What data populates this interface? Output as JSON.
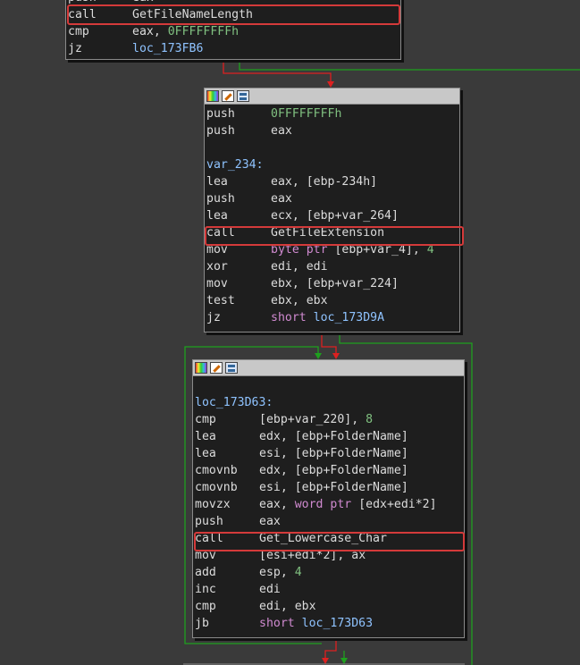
{
  "block1": {
    "lines": [
      {
        "mn": "push",
        "ops": [
          {
            "t": "eax",
            "c": "reg"
          }
        ]
      },
      {
        "mn": "call",
        "ops": [
          {
            "t": "GetFileNameLength",
            "c": "func"
          }
        ]
      },
      {
        "mn": "cmp",
        "ops": [
          {
            "t": "eax",
            "c": "reg"
          },
          {
            "t": ", ",
            "c": "sym"
          },
          {
            "t": "0FFFFFFFFh",
            "c": "num"
          }
        ]
      },
      {
        "mn": "jz",
        "ops": [
          {
            "t": "loc_173FB6",
            "c": "lbl"
          }
        ]
      }
    ]
  },
  "block2": {
    "lines": [
      {
        "mn": "push",
        "ops": [
          {
            "t": "0FFFFFFFFh",
            "c": "num"
          }
        ]
      },
      {
        "mn": "push",
        "ops": [
          {
            "t": "eax",
            "c": "reg"
          }
        ]
      },
      {
        "blank": true
      },
      {
        "label": "var_234:"
      },
      {
        "mn": "lea",
        "ops": [
          {
            "t": "eax",
            "c": "reg"
          },
          {
            "t": ", [",
            "c": "sym"
          },
          {
            "t": "ebp",
            "c": "reg"
          },
          {
            "t": "-234h]",
            "c": "sym"
          }
        ]
      },
      {
        "mn": "push",
        "ops": [
          {
            "t": "eax",
            "c": "reg"
          }
        ]
      },
      {
        "mn": "lea",
        "ops": [
          {
            "t": "ecx",
            "c": "reg"
          },
          {
            "t": ", [",
            "c": "sym"
          },
          {
            "t": "ebp+var_264",
            "c": "sym"
          },
          {
            "t": "]",
            "c": "sym"
          }
        ]
      },
      {
        "mn": "call",
        "ops": [
          {
            "t": "GetFileExtension",
            "c": "func"
          }
        ]
      },
      {
        "mn": "mov",
        "ops": [
          {
            "t": "byte ptr",
            "c": "kw"
          },
          {
            "t": " [",
            "c": "sym"
          },
          {
            "t": "ebp+var_4",
            "c": "sym"
          },
          {
            "t": "], ",
            "c": "sym"
          },
          {
            "t": "4",
            "c": "num"
          }
        ]
      },
      {
        "mn": "xor",
        "ops": [
          {
            "t": "edi",
            "c": "reg"
          },
          {
            "t": ", ",
            "c": "sym"
          },
          {
            "t": "edi",
            "c": "reg"
          }
        ]
      },
      {
        "mn": "mov",
        "ops": [
          {
            "t": "ebx",
            "c": "reg"
          },
          {
            "t": ", [",
            "c": "sym"
          },
          {
            "t": "ebp+var_224",
            "c": "sym"
          },
          {
            "t": "]",
            "c": "sym"
          }
        ]
      },
      {
        "mn": "test",
        "ops": [
          {
            "t": "ebx",
            "c": "reg"
          },
          {
            "t": ", ",
            "c": "sym"
          },
          {
            "t": "ebx",
            "c": "reg"
          }
        ]
      },
      {
        "mn": "jz",
        "ops": [
          {
            "t": "short",
            "c": "kw"
          },
          {
            "t": " ",
            "c": "sym"
          },
          {
            "t": "loc_173D9A",
            "c": "lbl"
          }
        ]
      }
    ]
  },
  "block3": {
    "lines": [
      {
        "blank": true
      },
      {
        "label": "loc_173D63:"
      },
      {
        "mn": "cmp",
        "ops": [
          {
            "t": "[",
            "c": "sym"
          },
          {
            "t": "ebp+var_220",
            "c": "sym"
          },
          {
            "t": "], ",
            "c": "sym"
          },
          {
            "t": "8",
            "c": "num"
          }
        ]
      },
      {
        "mn": "lea",
        "ops": [
          {
            "t": "edx",
            "c": "reg"
          },
          {
            "t": ", [",
            "c": "sym"
          },
          {
            "t": "ebp+FolderName",
            "c": "sym"
          },
          {
            "t": "]",
            "c": "sym"
          }
        ]
      },
      {
        "mn": "lea",
        "ops": [
          {
            "t": "esi",
            "c": "reg"
          },
          {
            "t": ", [",
            "c": "sym"
          },
          {
            "t": "ebp+FolderName",
            "c": "sym"
          },
          {
            "t": "]",
            "c": "sym"
          }
        ]
      },
      {
        "mn": "cmovnb",
        "ops": [
          {
            "t": "edx",
            "c": "reg"
          },
          {
            "t": ", [",
            "c": "sym"
          },
          {
            "t": "ebp+FolderName",
            "c": "sym"
          },
          {
            "t": "]",
            "c": "sym"
          }
        ]
      },
      {
        "mn": "cmovnb",
        "ops": [
          {
            "t": "esi",
            "c": "reg"
          },
          {
            "t": ", [",
            "c": "sym"
          },
          {
            "t": "ebp+FolderName",
            "c": "sym"
          },
          {
            "t": "]",
            "c": "sym"
          }
        ]
      },
      {
        "mn": "movzx",
        "ops": [
          {
            "t": "eax",
            "c": "reg"
          },
          {
            "t": ", ",
            "c": "sym"
          },
          {
            "t": "word ptr",
            "c": "kw"
          },
          {
            "t": " [",
            "c": "sym"
          },
          {
            "t": "edx+edi*2",
            "c": "sym"
          },
          {
            "t": "]",
            "c": "sym"
          }
        ]
      },
      {
        "mn": "push",
        "ops": [
          {
            "t": "eax",
            "c": "reg"
          }
        ]
      },
      {
        "mn": "call",
        "ops": [
          {
            "t": "Get_Lowercase_Char",
            "c": "func"
          }
        ]
      },
      {
        "mn": "mov",
        "ops": [
          {
            "t": "[",
            "c": "sym"
          },
          {
            "t": "esi+edi*2",
            "c": "sym"
          },
          {
            "t": "], ",
            "c": "sym"
          },
          {
            "t": "ax",
            "c": "reg"
          }
        ]
      },
      {
        "mn": "add",
        "ops": [
          {
            "t": "esp",
            "c": "reg"
          },
          {
            "t": ", ",
            "c": "sym"
          },
          {
            "t": "4",
            "c": "num"
          }
        ]
      },
      {
        "mn": "inc",
        "ops": [
          {
            "t": "edi",
            "c": "reg"
          }
        ]
      },
      {
        "mn": "cmp",
        "ops": [
          {
            "t": "edi",
            "c": "reg"
          },
          {
            "t": ", ",
            "c": "sym"
          },
          {
            "t": "ebx",
            "c": "reg"
          }
        ]
      },
      {
        "mn": "jb",
        "ops": [
          {
            "t": "short",
            "c": "kw"
          },
          {
            "t": " ",
            "c": "sym"
          },
          {
            "t": "loc_173D63",
            "c": "lbl"
          }
        ]
      }
    ]
  },
  "icons": [
    "color-palette-icon",
    "edit-icon",
    "graph-view-icon"
  ],
  "colors": {
    "background": "#3a3a3a",
    "block_bg": "#1e1e1e",
    "highlight_border": "#d43a3a",
    "edge_true": "#1ea01e",
    "edge_false": "#dd2020"
  }
}
